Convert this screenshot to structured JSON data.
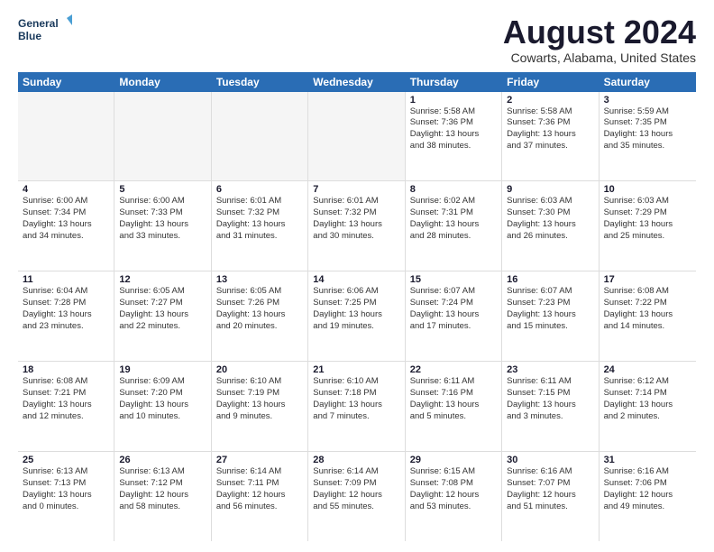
{
  "logo": {
    "line1": "General",
    "line2": "Blue"
  },
  "title": {
    "month_year": "August 2024",
    "location": "Cowarts, Alabama, United States"
  },
  "calendar": {
    "headers": [
      "Sunday",
      "Monday",
      "Tuesday",
      "Wednesday",
      "Thursday",
      "Friday",
      "Saturday"
    ],
    "rows": [
      [
        {
          "day": "",
          "info": "",
          "empty": true
        },
        {
          "day": "",
          "info": "",
          "empty": true
        },
        {
          "day": "",
          "info": "",
          "empty": true
        },
        {
          "day": "",
          "info": "",
          "empty": true
        },
        {
          "day": "1",
          "info": "Sunrise: 5:58 AM\nSunset: 7:36 PM\nDaylight: 13 hours\nand 38 minutes."
        },
        {
          "day": "2",
          "info": "Sunrise: 5:58 AM\nSunset: 7:36 PM\nDaylight: 13 hours\nand 37 minutes."
        },
        {
          "day": "3",
          "info": "Sunrise: 5:59 AM\nSunset: 7:35 PM\nDaylight: 13 hours\nand 35 minutes."
        }
      ],
      [
        {
          "day": "4",
          "info": "Sunrise: 6:00 AM\nSunset: 7:34 PM\nDaylight: 13 hours\nand 34 minutes."
        },
        {
          "day": "5",
          "info": "Sunrise: 6:00 AM\nSunset: 7:33 PM\nDaylight: 13 hours\nand 33 minutes."
        },
        {
          "day": "6",
          "info": "Sunrise: 6:01 AM\nSunset: 7:32 PM\nDaylight: 13 hours\nand 31 minutes."
        },
        {
          "day": "7",
          "info": "Sunrise: 6:01 AM\nSunset: 7:32 PM\nDaylight: 13 hours\nand 30 minutes."
        },
        {
          "day": "8",
          "info": "Sunrise: 6:02 AM\nSunset: 7:31 PM\nDaylight: 13 hours\nand 28 minutes."
        },
        {
          "day": "9",
          "info": "Sunrise: 6:03 AM\nSunset: 7:30 PM\nDaylight: 13 hours\nand 26 minutes."
        },
        {
          "day": "10",
          "info": "Sunrise: 6:03 AM\nSunset: 7:29 PM\nDaylight: 13 hours\nand 25 minutes."
        }
      ],
      [
        {
          "day": "11",
          "info": "Sunrise: 6:04 AM\nSunset: 7:28 PM\nDaylight: 13 hours\nand 23 minutes."
        },
        {
          "day": "12",
          "info": "Sunrise: 6:05 AM\nSunset: 7:27 PM\nDaylight: 13 hours\nand 22 minutes."
        },
        {
          "day": "13",
          "info": "Sunrise: 6:05 AM\nSunset: 7:26 PM\nDaylight: 13 hours\nand 20 minutes."
        },
        {
          "day": "14",
          "info": "Sunrise: 6:06 AM\nSunset: 7:25 PM\nDaylight: 13 hours\nand 19 minutes."
        },
        {
          "day": "15",
          "info": "Sunrise: 6:07 AM\nSunset: 7:24 PM\nDaylight: 13 hours\nand 17 minutes."
        },
        {
          "day": "16",
          "info": "Sunrise: 6:07 AM\nSunset: 7:23 PM\nDaylight: 13 hours\nand 15 minutes."
        },
        {
          "day": "17",
          "info": "Sunrise: 6:08 AM\nSunset: 7:22 PM\nDaylight: 13 hours\nand 14 minutes."
        }
      ],
      [
        {
          "day": "18",
          "info": "Sunrise: 6:08 AM\nSunset: 7:21 PM\nDaylight: 13 hours\nand 12 minutes."
        },
        {
          "day": "19",
          "info": "Sunrise: 6:09 AM\nSunset: 7:20 PM\nDaylight: 13 hours\nand 10 minutes."
        },
        {
          "day": "20",
          "info": "Sunrise: 6:10 AM\nSunset: 7:19 PM\nDaylight: 13 hours\nand 9 minutes."
        },
        {
          "day": "21",
          "info": "Sunrise: 6:10 AM\nSunset: 7:18 PM\nDaylight: 13 hours\nand 7 minutes."
        },
        {
          "day": "22",
          "info": "Sunrise: 6:11 AM\nSunset: 7:16 PM\nDaylight: 13 hours\nand 5 minutes."
        },
        {
          "day": "23",
          "info": "Sunrise: 6:11 AM\nSunset: 7:15 PM\nDaylight: 13 hours\nand 3 minutes."
        },
        {
          "day": "24",
          "info": "Sunrise: 6:12 AM\nSunset: 7:14 PM\nDaylight: 13 hours\nand 2 minutes."
        }
      ],
      [
        {
          "day": "25",
          "info": "Sunrise: 6:13 AM\nSunset: 7:13 PM\nDaylight: 13 hours\nand 0 minutes."
        },
        {
          "day": "26",
          "info": "Sunrise: 6:13 AM\nSunset: 7:12 PM\nDaylight: 12 hours\nand 58 minutes."
        },
        {
          "day": "27",
          "info": "Sunrise: 6:14 AM\nSunset: 7:11 PM\nDaylight: 12 hours\nand 56 minutes."
        },
        {
          "day": "28",
          "info": "Sunrise: 6:14 AM\nSunset: 7:09 PM\nDaylight: 12 hours\nand 55 minutes."
        },
        {
          "day": "29",
          "info": "Sunrise: 6:15 AM\nSunset: 7:08 PM\nDaylight: 12 hours\nand 53 minutes."
        },
        {
          "day": "30",
          "info": "Sunrise: 6:16 AM\nSunset: 7:07 PM\nDaylight: 12 hours\nand 51 minutes."
        },
        {
          "day": "31",
          "info": "Sunrise: 6:16 AM\nSunset: 7:06 PM\nDaylight: 12 hours\nand 49 minutes."
        }
      ]
    ]
  }
}
